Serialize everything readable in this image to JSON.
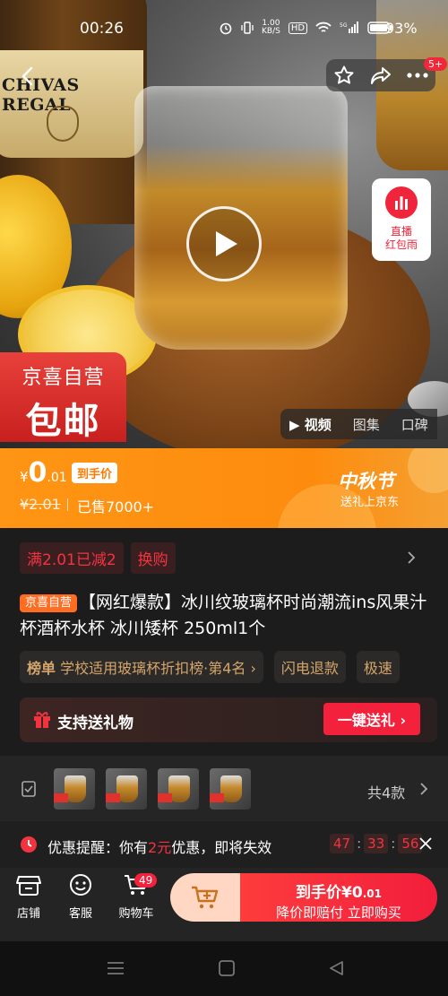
{
  "status_bar": {
    "time": "00:26",
    "speed": "1.00\nKB/S",
    "hd": "HD",
    "network": "5G",
    "battery": "93%"
  },
  "nav": {
    "msg_badge": "5+"
  },
  "hero": {
    "bottle_label": "CHIVAS REGAL",
    "live_line1": "直播",
    "live_line2": "红包雨",
    "self_op_line1": "京喜自营",
    "self_op_line2": "包邮"
  },
  "media_tabs": [
    "视频",
    "图集",
    "口碑"
  ],
  "price": {
    "currency": "¥",
    "integer": "0",
    "decimal": ".01",
    "tag": "到手价",
    "old_price": "¥2.01",
    "sold": "已售7000+",
    "festival": "中秋节",
    "festival_sub": "送礼上京东"
  },
  "promos": [
    "满2.01已减2",
    "换购"
  ],
  "title": {
    "tag": "京喜自营",
    "text": "【网红爆款】冰川纹玻璃杯时尚潮流ins风果汁杯酒杯水杯 冰川矮杯 250ml1个"
  },
  "chips": [
    {
      "label": "榜单",
      "text": "学校适用玻璃杯折扣榜·第4名 ›"
    },
    {
      "label": "",
      "text": "闪电退款"
    },
    {
      "label": "",
      "text": "极速"
    }
  ],
  "gift": {
    "text": "支持送礼物",
    "button": "一键送礼 ›"
  },
  "sku": {
    "count": "共4款"
  },
  "reminder": {
    "prefix": "优惠提醒：你有",
    "amount": "2元",
    "suffix": "优惠，即将失效",
    "timer": [
      "47",
      "33",
      "56"
    ]
  },
  "bottom": {
    "store": "店铺",
    "service": "客服",
    "cart": "购物车",
    "cart_count": "49",
    "buy_line1_prefix": "到手价¥",
    "buy_line1_int": "0",
    "buy_line1_dec": ".01",
    "buy_line2": "降价即赔付 立即购买"
  },
  "colors": {
    "accent_red": "#f3213b",
    "orange": "#ff9514",
    "gold": "#d4a56a"
  }
}
